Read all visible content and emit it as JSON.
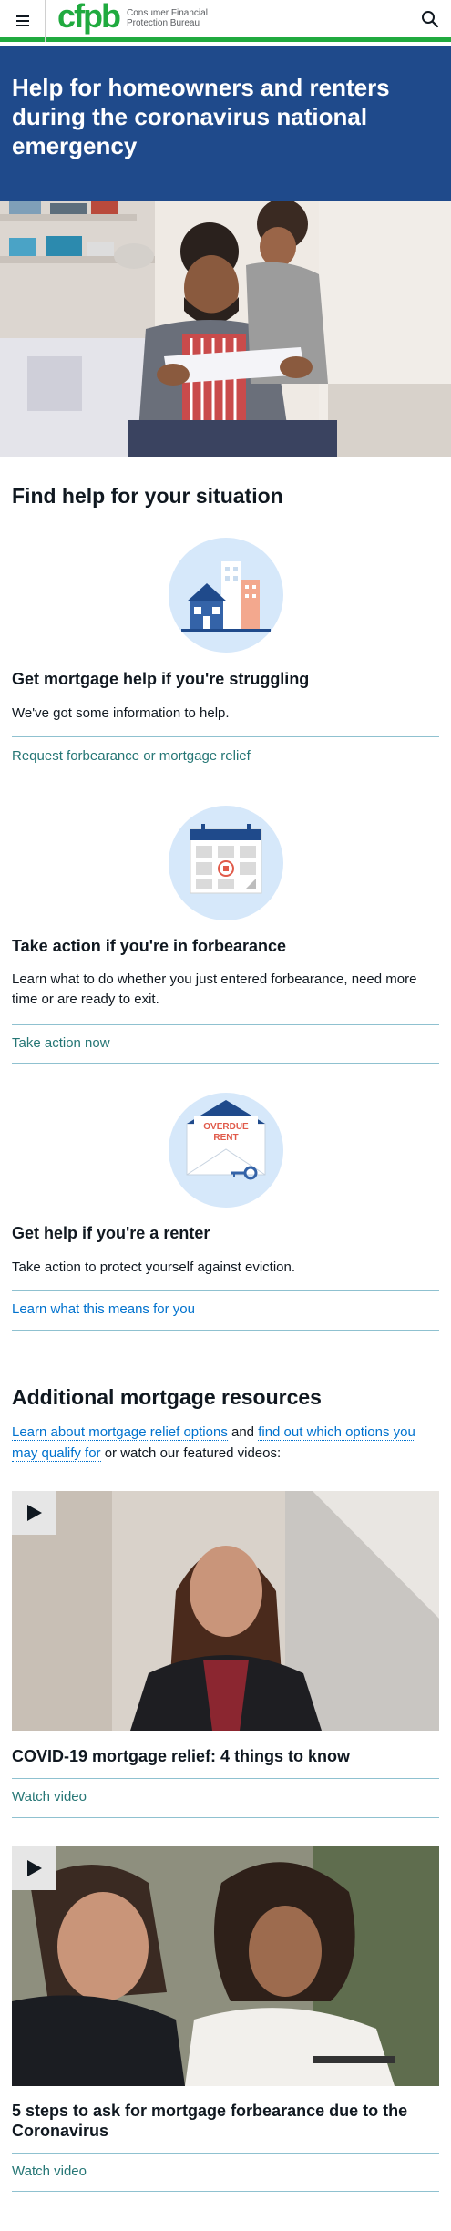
{
  "header": {
    "menu_icon": "menu-icon",
    "logo_mark": "cfpb",
    "logo_line1": "Consumer Financial",
    "logo_line2": "Protection Bureau",
    "search_icon": "search-icon",
    "accent_color": "#20aa3f"
  },
  "hero": {
    "title": "Help for homeowners and renters during the coronavirus national emergency",
    "band_color": "#1f4a8b"
  },
  "situation": {
    "title": "Find help for your situation",
    "cards": [
      {
        "icon": "house-buildings-icon",
        "heading": "Get mortgage help if you're struggling",
        "description": "We've got some information to help.",
        "link": "Request forbearance or mortgage relief"
      },
      {
        "icon": "calendar-icon",
        "heading": "Take action if you're in forbearance",
        "description": "Learn what to do whether you just entered forbearance, need more time or are ready to exit.",
        "link": "Take action now"
      },
      {
        "icon": "overdue-rent-envelope-icon",
        "icon_text_1": "OVERDUE",
        "icon_text_2": "RENT",
        "heading": "Get help if you're a renter",
        "description": "Take action to protect yourself against eviction.",
        "link": "Learn what this means for you"
      }
    ]
  },
  "resources": {
    "title": "Additional mortgage resources",
    "link1": "Learn about mortgage relief options",
    "and_text": " and ",
    "link2": "find out which options you may qualify for",
    "tail_text": " or watch our featured videos:",
    "videos": [
      {
        "title": "COVID-19 mortgage relief: 4 things to know",
        "link": "Watch video",
        "play_icon": "play-icon"
      },
      {
        "title": "5 steps to ask for mortgage forbearance due to the Coronavirus",
        "link": "Watch video",
        "play_icon": "play-icon"
      }
    ]
  }
}
